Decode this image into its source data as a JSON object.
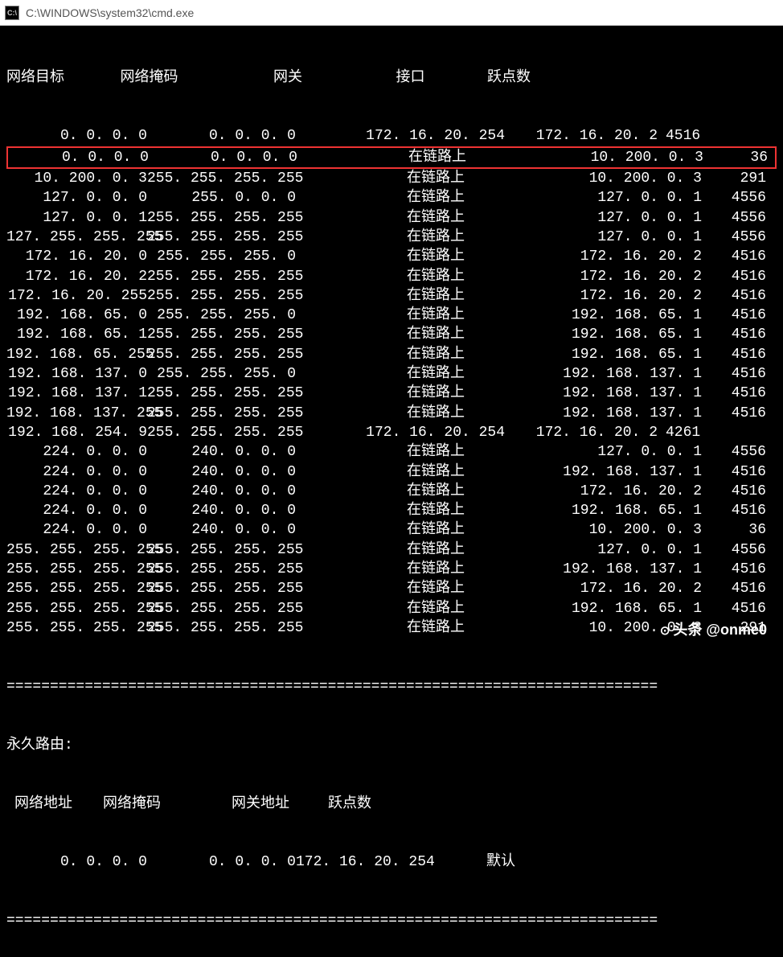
{
  "window": {
    "title": "C:\\WINDOWS\\system32\\cmd.exe",
    "icon_text": "C:\\"
  },
  "headers": {
    "dest": "网络目标",
    "mask": "网络掩码",
    "gateway": "网关",
    "iface": "接口",
    "metric": "跃点数"
  },
  "on_link": "在链路上",
  "routes": [
    {
      "dest": "0.0.0.0",
      "mask": "0.0.0.0",
      "gw": "172.16.20.254",
      "iface": "172.16.20.2",
      "metric": "4516",
      "highlight": false
    },
    {
      "dest": "0.0.0.0",
      "mask": "0.0.0.0",
      "gw": "在链路上",
      "iface": "10.200.0.3",
      "metric": "36",
      "highlight": true
    },
    {
      "dest": "10.200.0.3",
      "mask": "255.255.255.255",
      "gw": "在链路上",
      "iface": "10.200.0.3",
      "metric": "291",
      "highlight": false
    },
    {
      "dest": "127.0.0.0",
      "mask": "255.0.0.0",
      "gw": "在链路上",
      "iface": "127.0.0.1",
      "metric": "4556",
      "highlight": false
    },
    {
      "dest": "127.0.0.1",
      "mask": "255.255.255.255",
      "gw": "在链路上",
      "iface": "127.0.0.1",
      "metric": "4556",
      "highlight": false
    },
    {
      "dest": "127.255.255.255",
      "mask": "255.255.255.255",
      "gw": "在链路上",
      "iface": "127.0.0.1",
      "metric": "4556",
      "highlight": false
    },
    {
      "dest": "172.16.20.0",
      "mask": "255.255.255.0",
      "gw": "在链路上",
      "iface": "172.16.20.2",
      "metric": "4516",
      "highlight": false
    },
    {
      "dest": "172.16.20.2",
      "mask": "255.255.255.255",
      "gw": "在链路上",
      "iface": "172.16.20.2",
      "metric": "4516",
      "highlight": false
    },
    {
      "dest": "172.16.20.255",
      "mask": "255.255.255.255",
      "gw": "在链路上",
      "iface": "172.16.20.2",
      "metric": "4516",
      "highlight": false
    },
    {
      "dest": "192.168.65.0",
      "mask": "255.255.255.0",
      "gw": "在链路上",
      "iface": "192.168.65.1",
      "metric": "4516",
      "highlight": false
    },
    {
      "dest": "192.168.65.1",
      "mask": "255.255.255.255",
      "gw": "在链路上",
      "iface": "192.168.65.1",
      "metric": "4516",
      "highlight": false
    },
    {
      "dest": "192.168.65.255",
      "mask": "255.255.255.255",
      "gw": "在链路上",
      "iface": "192.168.65.1",
      "metric": "4516",
      "highlight": false
    },
    {
      "dest": "192.168.137.0",
      "mask": "255.255.255.0",
      "gw": "在链路上",
      "iface": "192.168.137.1",
      "metric": "4516",
      "highlight": false
    },
    {
      "dest": "192.168.137.1",
      "mask": "255.255.255.255",
      "gw": "在链路上",
      "iface": "192.168.137.1",
      "metric": "4516",
      "highlight": false
    },
    {
      "dest": "192.168.137.255",
      "mask": "255.255.255.255",
      "gw": "在链路上",
      "iface": "192.168.137.1",
      "metric": "4516",
      "highlight": false
    },
    {
      "dest": "192.168.254.9",
      "mask": "255.255.255.255",
      "gw": "172.16.20.254",
      "iface": "172.16.20.2",
      "metric": "4261",
      "highlight": false
    },
    {
      "dest": "224.0.0.0",
      "mask": "240.0.0.0",
      "gw": "在链路上",
      "iface": "127.0.0.1",
      "metric": "4556",
      "highlight": false
    },
    {
      "dest": "224.0.0.0",
      "mask": "240.0.0.0",
      "gw": "在链路上",
      "iface": "192.168.137.1",
      "metric": "4516",
      "highlight": false
    },
    {
      "dest": "224.0.0.0",
      "mask": "240.0.0.0",
      "gw": "在链路上",
      "iface": "172.16.20.2",
      "metric": "4516",
      "highlight": false
    },
    {
      "dest": "224.0.0.0",
      "mask": "240.0.0.0",
      "gw": "在链路上",
      "iface": "192.168.65.1",
      "metric": "4516",
      "highlight": false
    },
    {
      "dest": "224.0.0.0",
      "mask": "240.0.0.0",
      "gw": "在链路上",
      "iface": "10.200.0.3",
      "metric": "36",
      "highlight": false
    },
    {
      "dest": "255.255.255.255",
      "mask": "255.255.255.255",
      "gw": "在链路上",
      "iface": "127.0.0.1",
      "metric": "4556",
      "highlight": false
    },
    {
      "dest": "255.255.255.255",
      "mask": "255.255.255.255",
      "gw": "在链路上",
      "iface": "192.168.137.1",
      "metric": "4516",
      "highlight": false
    },
    {
      "dest": "255.255.255.255",
      "mask": "255.255.255.255",
      "gw": "在链路上",
      "iface": "172.16.20.2",
      "metric": "4516",
      "highlight": false
    },
    {
      "dest": "255.255.255.255",
      "mask": "255.255.255.255",
      "gw": "在链路上",
      "iface": "192.168.65.1",
      "metric": "4516",
      "highlight": false
    },
    {
      "dest": "255.255.255.255",
      "mask": "255.255.255.255",
      "gw": "在链路上",
      "iface": "10.200.0.3",
      "metric": "291",
      "highlight": false
    }
  ],
  "divider": "===========================================================================",
  "persistent": {
    "title": "永久路由:",
    "headers": {
      "addr": "网络地址",
      "mask": "网络掩码",
      "gw": "网关地址",
      "metric": "跃点数"
    },
    "row": {
      "addr": "0.0.0.0",
      "mask": "0.0.0.0",
      "gw": "172.16.20.254",
      "metric": "默认"
    }
  },
  "watermark": {
    "prefix": "头条",
    "handle": "@onme0"
  }
}
